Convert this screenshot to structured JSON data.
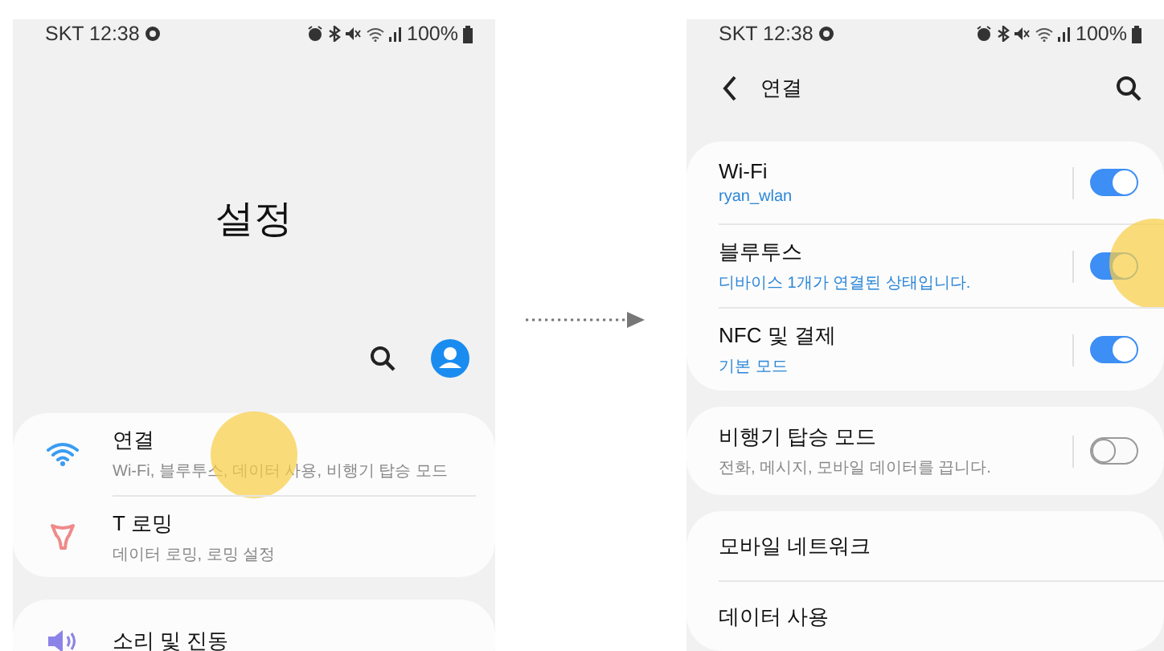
{
  "screens": [
    {
      "kind": "home",
      "status_bar": {
        "carrier_time": "SKT 12:38",
        "battery": "100%"
      },
      "title": "설정",
      "groups": [
        {
          "items": [
            {
              "kind": "wifi",
              "title": "연결",
              "subtitle": "Wi-Fi, 블루투스, 데이터 사용, 비행기 탑승 모드",
              "tapped": true
            },
            {
              "kind": "roaming",
              "title": "T 로밍",
              "subtitle": "데이터 로밍, 로밍 설정",
              "tapped": false
            }
          ]
        },
        {
          "items": [
            {
              "kind": "speaker",
              "title": "소리 및 진동",
              "tapped": false
            }
          ]
        }
      ]
    },
    {
      "kind": "list",
      "status_bar": {
        "carrier_time": "SKT 12:38",
        "battery": "100%"
      },
      "title": "연결",
      "groups": [
        {
          "items": [
            {
              "kind": "toggle",
              "title": "Wi-Fi",
              "subtitle": "ryan_wlan",
              "subtitle_accent": true,
              "on": true,
              "tapped": false
            },
            {
              "kind": "toggle",
              "title": "블루투스",
              "subtitle": "디바이스 1개가 연결된 상태입니다.",
              "subtitle_accent": true,
              "on": true,
              "tapped": true
            },
            {
              "kind": "toggle",
              "title": "NFC 및 결제",
              "subtitle": "기본 모드",
              "subtitle_accent": true,
              "on": true,
              "tapped": false
            }
          ]
        },
        {
          "items": [
            {
              "kind": "toggle",
              "title": "비행기 탑승 모드",
              "subtitle": "전화, 메시지, 모바일 데이터를 끕니다.",
              "subtitle_accent": false,
              "on": false,
              "tapped": false
            }
          ]
        },
        {
          "items": [
            {
              "kind": "plain",
              "title": "모바일 네트워크",
              "tapped": false
            },
            {
              "kind": "plain",
              "title": "데이터 사용",
              "tapped": false
            }
          ]
        }
      ]
    }
  ]
}
